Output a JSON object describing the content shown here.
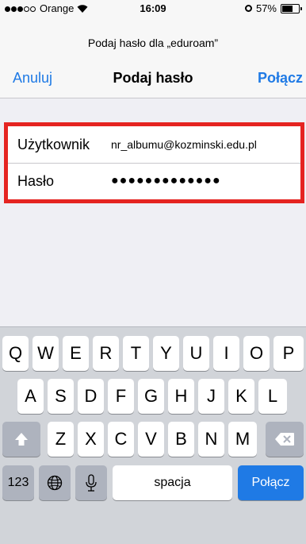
{
  "status_bar": {
    "carrier": "Orange",
    "time": "16:09",
    "battery": "57%",
    "battery_level": 0.57
  },
  "nav": {
    "prompt": "Podaj hasło dla „eduroam”",
    "cancel_label": "Anuluj",
    "title": "Podaj hasło",
    "connect_label": "Połącz",
    "accent_color": "#1f7ae5"
  },
  "form": {
    "username_label": "Użytkownik",
    "username_value": "nr_albumu@kozminski.edu.pl",
    "password_label": "Hasło",
    "password_value": "●●●●●●●●●●●●●",
    "highlight_color": "#e52421"
  },
  "keyboard": {
    "row1": [
      "Q",
      "W",
      "E",
      "R",
      "T",
      "Y",
      "U",
      "I",
      "O",
      "P"
    ],
    "row2": [
      "A",
      "S",
      "D",
      "F",
      "G",
      "H",
      "J",
      "K",
      "L"
    ],
    "row3": [
      "Z",
      "X",
      "C",
      "V",
      "B",
      "N",
      "M"
    ],
    "numbers_label": "123",
    "space_label": "spacja",
    "return_label": "Połącz",
    "shift_icon": "shift-icon",
    "delete_icon": "delete-icon",
    "globe_icon": "globe-icon",
    "mic_icon": "mic-icon"
  }
}
